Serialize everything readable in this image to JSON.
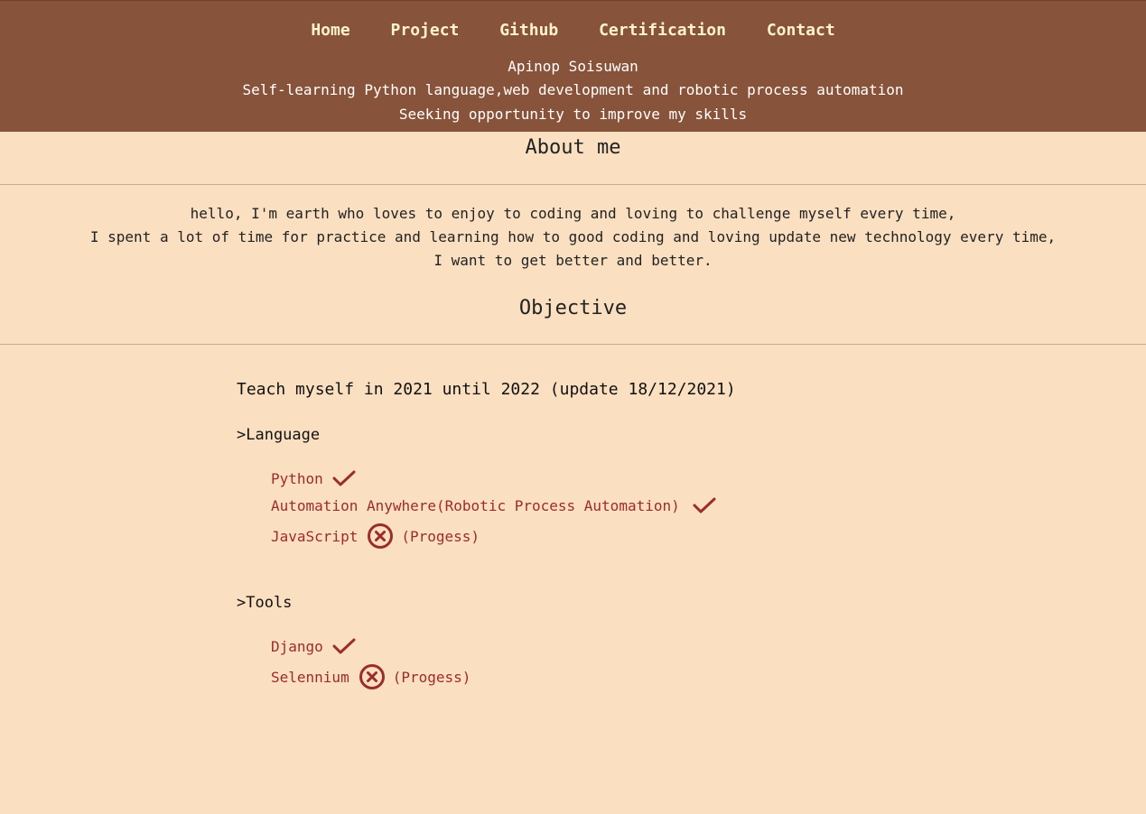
{
  "nav": {
    "items": [
      "Home",
      "Project",
      "Github",
      "Certification",
      "Contact"
    ]
  },
  "intro": {
    "name": "Apinop Soisuwan",
    "tagline": "Self-learning Python language,web development and robotic process automation",
    "goal": "Seeking opportunity to improve my skills"
  },
  "about": {
    "title": "About me",
    "lines": [
      "hello, I'm earth who loves to enjoy to coding and loving to challenge myself every time,",
      "I spent a lot of time for practice and learning how to good coding and loving update new technology every time,",
      "I want to get better and better."
    ]
  },
  "objective": {
    "title": "Objective",
    "heading": "Teach myself in 2021 until 2022 (update 18/12/2021)",
    "language": {
      "title": ">Language",
      "items": [
        {
          "label": "Python",
          "status": "done",
          "icon": "check-icon",
          "note": ""
        },
        {
          "label": "Automation Anywhere(Robotic Process Automation)",
          "status": "done",
          "icon": "check-icon",
          "note": ""
        },
        {
          "label": "JavaScript",
          "status": "progress",
          "icon": "x-circle-icon",
          "note": "(Progess)"
        }
      ]
    },
    "tools": {
      "title": ">Tools",
      "items": [
        {
          "label": "Django",
          "status": "done",
          "icon": "check-icon",
          "note": ""
        },
        {
          "label": "Selennium",
          "status": "progress",
          "icon": "x-circle-icon",
          "note": "(Progess)"
        }
      ]
    }
  },
  "colors": {
    "header_bg": "#87533a",
    "page_bg": "#fbdfc1",
    "nav_text": "#fff4c9",
    "item_text": "#9b2c2c"
  }
}
